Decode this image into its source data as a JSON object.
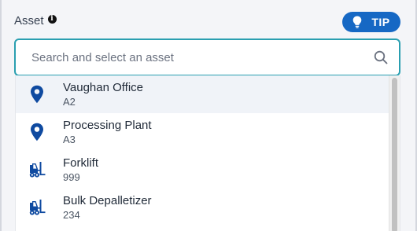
{
  "field": {
    "label": "Asset",
    "info_icon": "info-icon",
    "tip_label": "TIP",
    "tip_icon": "lightbulb-icon"
  },
  "search": {
    "placeholder": "Search and select an asset",
    "value": "",
    "icon": "search-icon"
  },
  "options": [
    {
      "title": "Vaughan Office",
      "code": "A2",
      "icon": "location-pin-icon"
    },
    {
      "title": "Processing Plant",
      "code": "A3",
      "icon": "location-pin-icon"
    },
    {
      "title": "Forklift",
      "code": "999",
      "icon": "forklift-icon"
    },
    {
      "title": "Bulk Depalletizer",
      "code": "234",
      "icon": "forklift-icon"
    }
  ],
  "colors": {
    "accent": "#1668c4",
    "focus_border": "#2a9fb0",
    "icon": "#0f4aa0",
    "highlight_row": "#f0f3f8"
  }
}
